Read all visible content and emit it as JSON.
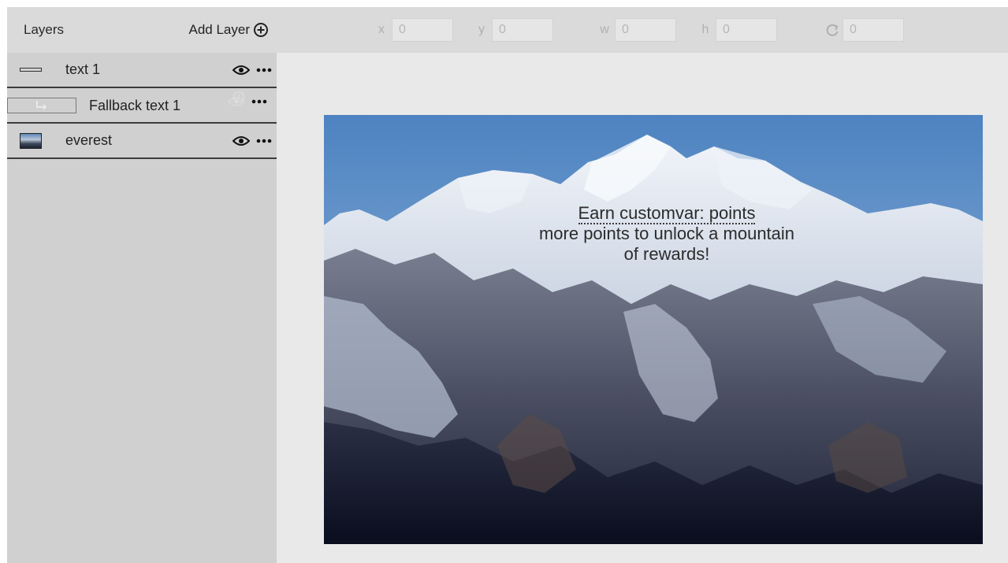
{
  "sidebar": {
    "title": "Layers",
    "add_layer_label": "Add Layer",
    "layers": [
      {
        "name": "text 1",
        "type": "text",
        "visible": true
      },
      {
        "name": "Fallback text 1",
        "type": "fallback",
        "visible": false
      },
      {
        "name": "everest",
        "type": "image",
        "visible": true
      }
    ]
  },
  "toolbar": {
    "x": {
      "label": "x",
      "value": "0"
    },
    "y": {
      "label": "y",
      "value": "0"
    },
    "w": {
      "label": "w",
      "value": "0"
    },
    "h": {
      "label": "h",
      "value": "0"
    },
    "rotation": {
      "value": "0"
    }
  },
  "canvas": {
    "overlay_var": "Earn customvar: points",
    "overlay_line2": "more points to unlock a mountain",
    "overlay_line3": "of rewards!"
  },
  "colors": {
    "sidebar_bg": "#d0d0d0",
    "header_bg": "#dadada",
    "workspace_bg": "#e9e9e9",
    "sky": "#5b8ac2"
  }
}
